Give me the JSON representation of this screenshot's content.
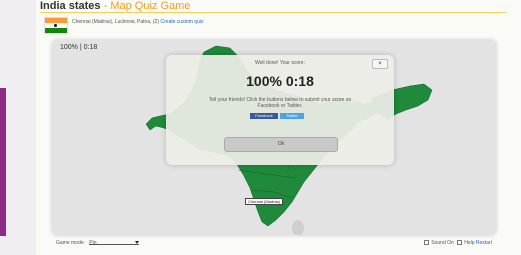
{
  "header": {
    "title": "India states",
    "subtitle": "Map Quiz Game",
    "separator": " - "
  },
  "description": {
    "text": "Chennai (Madras), Lucknow, Patna, (2)",
    "link": "Create custom quiz"
  },
  "game": {
    "timer": "100% | 0:18",
    "modal": {
      "message": "Well done! Your score:",
      "score": "100% 0:18",
      "share_text": "Tell your friends! Click the buttons below to submit your score on Facebook or Twitter.",
      "facebook_label": "Facebook",
      "twitter_label": "Twitter",
      "ok_label": "Ok",
      "close_label": "×"
    },
    "city_label": "Chennai (Madras)"
  },
  "footer": {
    "game_mode_label": "Game mode:",
    "game_mode_value": "Pin",
    "sound_label": "Sound On",
    "help_label": "Help",
    "restart_label": "Restart"
  },
  "colors": {
    "map_land": "#1f8a3c",
    "map_background": "#e3e3e3",
    "title_accent": "#f0a020",
    "side_bar": "#8c2c86"
  }
}
